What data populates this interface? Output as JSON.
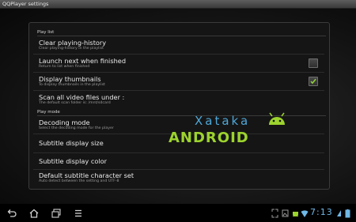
{
  "window": {
    "title": "QQPlayer settings"
  },
  "settings": {
    "playlist_header": "Play list",
    "playmode_header": "Play mode",
    "items": [
      {
        "title": "Clear playing-history",
        "subtitle": "Clear playing-history in the playlist"
      },
      {
        "title": "Launch next when finished",
        "subtitle": "Return to list when finished",
        "checked": false
      },
      {
        "title": "Display thumbnails",
        "subtitle": "To display thumbnails in the playlist",
        "checked": true
      },
      {
        "title": "Scan all video files under :",
        "subtitle": "The default scan folder is: /mnt/sdcard"
      },
      {
        "title": "Decoding mode",
        "subtitle": "Select the decoding mode for the player"
      },
      {
        "title": "Subtitle display size",
        "subtitle": ""
      },
      {
        "title": "Subtitle display color",
        "subtitle": ""
      },
      {
        "title": "Default subtitle character set",
        "subtitle": "Auto detect between the setting and UTF-8"
      }
    ]
  },
  "watermark": {
    "top": "Xataka",
    "bottom": "ANDROID",
    "top_color": "#4fa7d8",
    "bottom_color": "#9cd32e"
  },
  "statusbar": {
    "time": "7:13",
    "accent": "#6fb8e8"
  },
  "navbar": {
    "icons": [
      "back-icon",
      "home-icon",
      "recent-apps-icon",
      "menu-icon"
    ]
  }
}
